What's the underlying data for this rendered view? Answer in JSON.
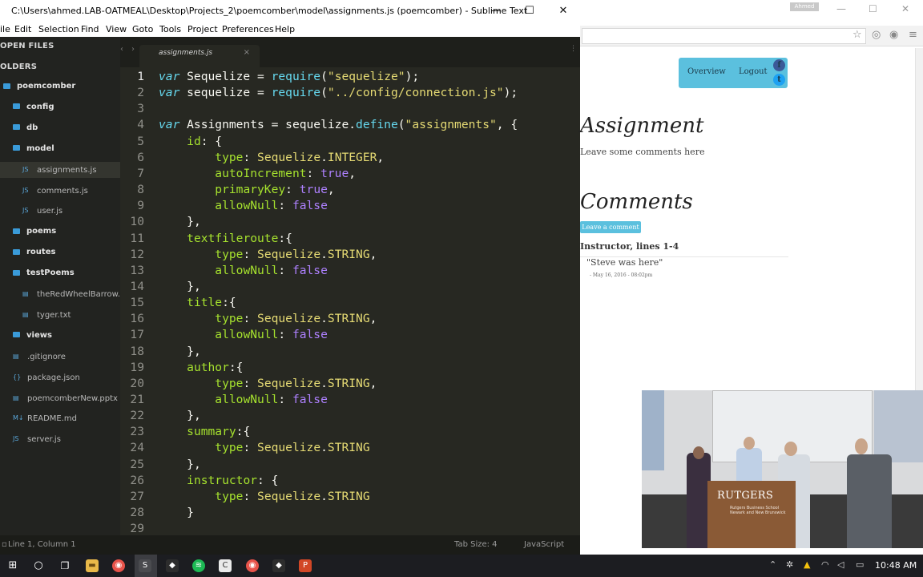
{
  "sublime": {
    "title": "C:\\Users\\ahmed.LAB-OATMEAL\\Desktop\\Projects_2\\poemcomber\\model\\assignments.js (poemcomber) - Sublime Text",
    "menu": [
      "ile",
      "Edit",
      "Selection",
      "Find",
      "View",
      "Goto",
      "Tools",
      "Project",
      "Preferences",
      "Help"
    ],
    "sidebar_open_files": "OPEN FILES",
    "sidebar_folders": "OLDERS",
    "tree": [
      {
        "label": "poemcomber",
        "kind": "folder",
        "depth": 0
      },
      {
        "label": "config",
        "kind": "folder",
        "depth": 1
      },
      {
        "label": "db",
        "kind": "folder",
        "depth": 1
      },
      {
        "label": "model",
        "kind": "folder",
        "depth": 1
      },
      {
        "label": "assignments.js",
        "kind": "file",
        "depth": 2,
        "selected": true
      },
      {
        "label": "comments.js",
        "kind": "file",
        "depth": 2
      },
      {
        "label": "user.js",
        "kind": "file",
        "depth": 2
      },
      {
        "label": "poems",
        "kind": "folder",
        "depth": 1
      },
      {
        "label": "routes",
        "kind": "folder",
        "depth": 1
      },
      {
        "label": "testPoems",
        "kind": "folder",
        "depth": 1
      },
      {
        "label": "theRedWheelBarrow.txt",
        "kind": "file",
        "depth": 2
      },
      {
        "label": "tyger.txt",
        "kind": "file",
        "depth": 2
      },
      {
        "label": "views",
        "kind": "folder",
        "depth": 1
      },
      {
        "label": ".gitignore",
        "kind": "file",
        "depth": 1
      },
      {
        "label": "package.json",
        "kind": "file",
        "depth": 1
      },
      {
        "label": "poemcomberNew.pptx",
        "kind": "file",
        "depth": 1
      },
      {
        "label": "README.md",
        "kind": "file",
        "depth": 1
      },
      {
        "label": "server.js",
        "kind": "file",
        "depth": 1
      }
    ],
    "tab": {
      "label": "assignments.js",
      "close": "×"
    },
    "code": [
      [
        [
          "kw",
          "var"
        ],
        [
          "id",
          " Sequelize "
        ],
        [
          "pun",
          "= "
        ],
        [
          "fn",
          "require"
        ],
        [
          "pun",
          "("
        ],
        [
          "str",
          "\"sequelize\""
        ],
        [
          "pun",
          ");"
        ]
      ],
      [
        [
          "kw",
          "var"
        ],
        [
          "id",
          " sequelize "
        ],
        [
          "pun",
          "= "
        ],
        [
          "fn",
          "require"
        ],
        [
          "pun",
          "("
        ],
        [
          "str",
          "\"../config/connection.js\""
        ],
        [
          "pun",
          ");"
        ]
      ],
      [],
      [
        [
          "kw",
          "var"
        ],
        [
          "id",
          " Assignments "
        ],
        [
          "pun",
          "= sequelize."
        ],
        [
          "fn",
          "define"
        ],
        [
          "pun",
          "("
        ],
        [
          "str",
          "\"assignments\""
        ],
        [
          "pun",
          ", {"
        ]
      ],
      [
        [
          "id",
          "    "
        ],
        [
          "prop",
          "id"
        ],
        [
          "pun",
          ": {"
        ]
      ],
      [
        [
          "id",
          "        "
        ],
        [
          "prop",
          "type"
        ],
        [
          "pun",
          ": "
        ],
        [
          "cls",
          "Sequelize"
        ],
        [
          "pun",
          "."
        ],
        [
          "const",
          "INTEGER"
        ],
        [
          "pun",
          ","
        ]
      ],
      [
        [
          "id",
          "        "
        ],
        [
          "prop",
          "autoIncrement"
        ],
        [
          "pun",
          ": "
        ],
        [
          "bool",
          "true"
        ],
        [
          "pun",
          ","
        ]
      ],
      [
        [
          "id",
          "        "
        ],
        [
          "prop",
          "primaryKey"
        ],
        [
          "pun",
          ": "
        ],
        [
          "bool",
          "true"
        ],
        [
          "pun",
          ","
        ]
      ],
      [
        [
          "id",
          "        "
        ],
        [
          "prop",
          "allowNull"
        ],
        [
          "pun",
          ": "
        ],
        [
          "bool",
          "false"
        ]
      ],
      [
        [
          "id",
          "    "
        ],
        [
          "pun",
          "},"
        ]
      ],
      [
        [
          "id",
          "    "
        ],
        [
          "prop",
          "textfileroute"
        ],
        [
          "pun",
          ":{"
        ]
      ],
      [
        [
          "id",
          "        "
        ],
        [
          "prop",
          "type"
        ],
        [
          "pun",
          ": "
        ],
        [
          "cls",
          "Sequelize"
        ],
        [
          "pun",
          "."
        ],
        [
          "const",
          "STRING"
        ],
        [
          "pun",
          ","
        ]
      ],
      [
        [
          "id",
          "        "
        ],
        [
          "prop",
          "allowNull"
        ],
        [
          "pun",
          ": "
        ],
        [
          "bool",
          "false"
        ]
      ],
      [
        [
          "id",
          "    "
        ],
        [
          "pun",
          "},"
        ]
      ],
      [
        [
          "id",
          "    "
        ],
        [
          "prop",
          "title"
        ],
        [
          "pun",
          ":{"
        ]
      ],
      [
        [
          "id",
          "        "
        ],
        [
          "prop",
          "type"
        ],
        [
          "pun",
          ": "
        ],
        [
          "cls",
          "Sequelize"
        ],
        [
          "pun",
          "."
        ],
        [
          "const",
          "STRING"
        ],
        [
          "pun",
          ","
        ]
      ],
      [
        [
          "id",
          "        "
        ],
        [
          "prop",
          "allowNull"
        ],
        [
          "pun",
          ": "
        ],
        [
          "bool",
          "false"
        ]
      ],
      [
        [
          "id",
          "    "
        ],
        [
          "pun",
          "},"
        ]
      ],
      [
        [
          "id",
          "    "
        ],
        [
          "prop",
          "author"
        ],
        [
          "pun",
          ":{"
        ]
      ],
      [
        [
          "id",
          "        "
        ],
        [
          "prop",
          "type"
        ],
        [
          "pun",
          ": "
        ],
        [
          "cls",
          "Sequelize"
        ],
        [
          "pun",
          "."
        ],
        [
          "const",
          "STRING"
        ],
        [
          "pun",
          ","
        ]
      ],
      [
        [
          "id",
          "        "
        ],
        [
          "prop",
          "allowNull"
        ],
        [
          "pun",
          ": "
        ],
        [
          "bool",
          "false"
        ]
      ],
      [
        [
          "id",
          "    "
        ],
        [
          "pun",
          "},"
        ]
      ],
      [
        [
          "id",
          "    "
        ],
        [
          "prop",
          "summary"
        ],
        [
          "pun",
          ":{"
        ]
      ],
      [
        [
          "id",
          "        "
        ],
        [
          "prop",
          "type"
        ],
        [
          "pun",
          ": "
        ],
        [
          "cls",
          "Sequelize"
        ],
        [
          "pun",
          "."
        ],
        [
          "const",
          "STRING"
        ]
      ],
      [
        [
          "id",
          "    "
        ],
        [
          "pun",
          "},"
        ]
      ],
      [
        [
          "id",
          "    "
        ],
        [
          "prop",
          "instructor"
        ],
        [
          "pun",
          ": {"
        ]
      ],
      [
        [
          "id",
          "        "
        ],
        [
          "prop",
          "type"
        ],
        [
          "pun",
          ": "
        ],
        [
          "cls",
          "Sequelize"
        ],
        [
          "pun",
          "."
        ],
        [
          "const",
          "STRING"
        ]
      ],
      [
        [
          "id",
          "    "
        ],
        [
          "pun",
          "}"
        ]
      ],
      []
    ],
    "current_line": 1,
    "status": {
      "position": "Line 1, Column 1",
      "tab_size": "Tab Size: 4",
      "syntax": "JavaScript"
    }
  },
  "browser": {
    "user_badge": "Ahmed",
    "nav": {
      "overview": "Overview",
      "logout": "Logout"
    },
    "heading": "Assignment",
    "subheading": "Leave some comments here",
    "comments_heading": "Comments",
    "leave_comment_button": "Leave a comment",
    "comment": {
      "author": "Instructor, lines 1-4",
      "body": "\"Steve was here\"",
      "date": "- May 16, 2016 - 08:02pm"
    }
  },
  "video": {
    "logo": "RUTGERS",
    "logo_sub": "Rutgers Business School\nNewark and New Brunswick"
  },
  "taskbar": {
    "clock": "10:48 AM"
  },
  "colors": {
    "editor_bg": "#272822",
    "accent": "#5bc0de",
    "keyword": "#66d9ef",
    "string": "#e6db74",
    "property": "#a6e22e",
    "boolean": "#ae81ff"
  }
}
